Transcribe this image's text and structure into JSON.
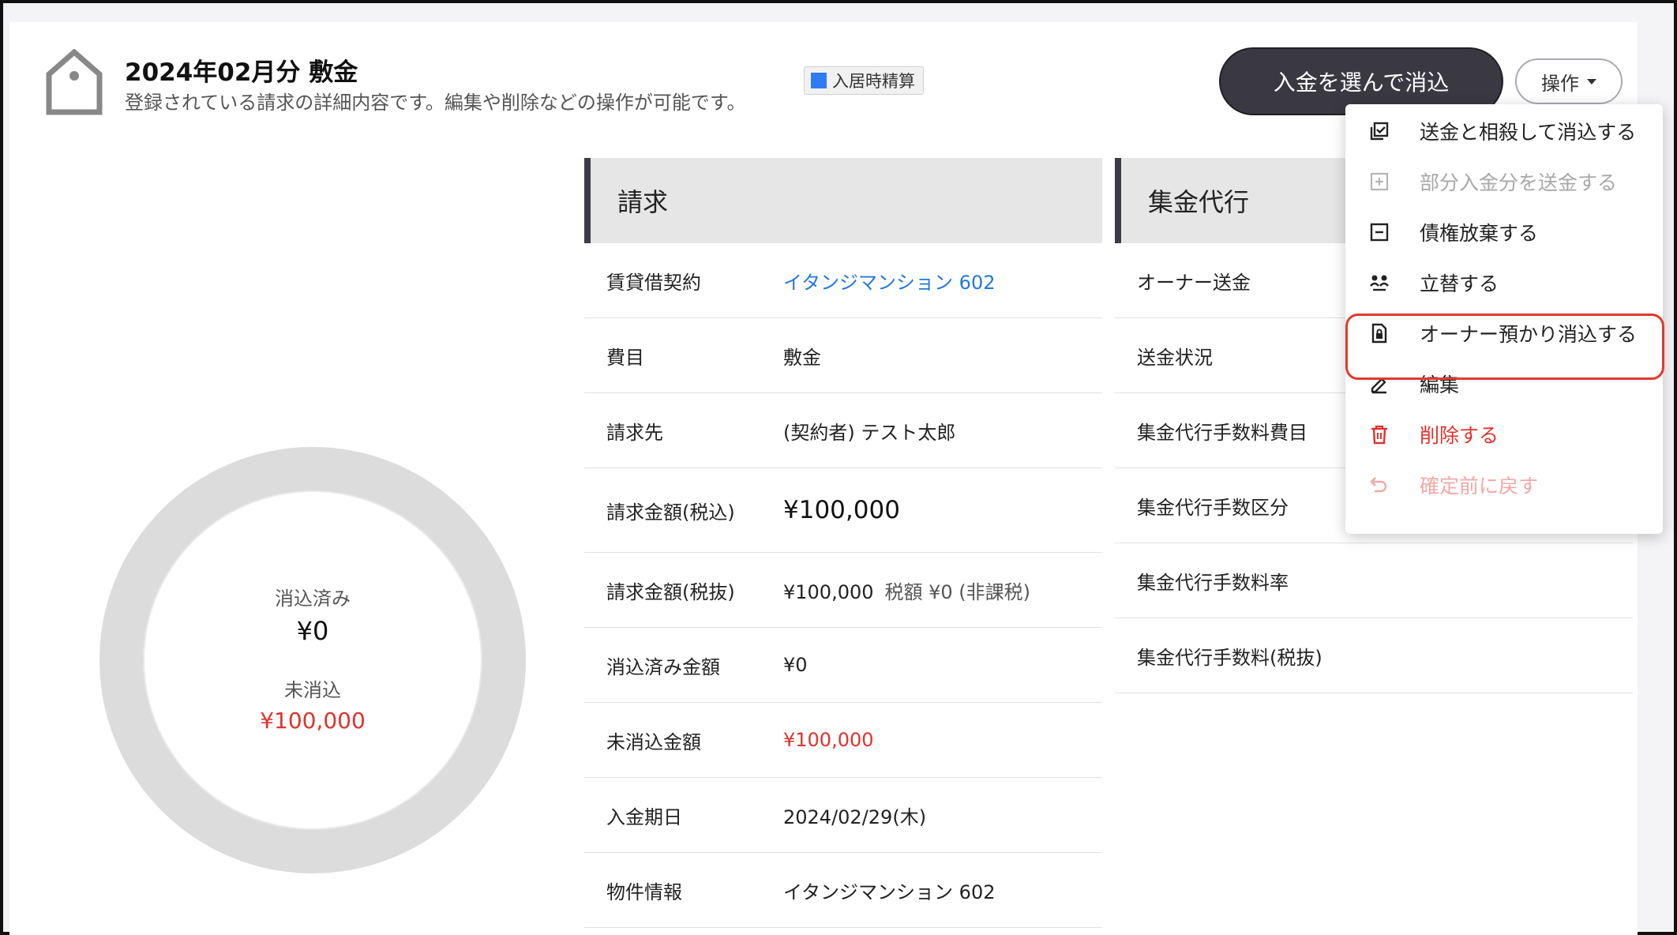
{
  "header": {
    "title": "2024年02月分 敷金",
    "subtitle": "登録されている請求の詳細内容です。編集や削除などの操作が可能です。",
    "badge_label": "入居時精算",
    "badge_color": "#2f7bf5",
    "primary_button": "入金を選んで消込",
    "ops_button": "操作"
  },
  "summary": {
    "cleared_label": "消込済み",
    "cleared_value": "¥0",
    "uncleared_label": "未消込",
    "uncleared_value": "¥100,000",
    "cleared_fraction": 0
  },
  "billing": {
    "heading": "請求",
    "rows": [
      {
        "label": "賃貸借契約",
        "value": "イタンジマンション 602"
      },
      {
        "label": "費目",
        "value": "敷金"
      },
      {
        "label": "請求先",
        "value": "(契約者) テスト太郎"
      },
      {
        "label": "請求金額(税込)",
        "value": "¥100,000"
      },
      {
        "label": "請求金額(税抜)",
        "value": "¥100,000",
        "sub": "税額 ¥0 (非課税)"
      },
      {
        "label": "消込済み金額",
        "value": "¥0"
      },
      {
        "label": "未消込金額",
        "value": "¥100,000"
      },
      {
        "label": "入金期日",
        "value": "2024/02/29(木)"
      },
      {
        "label": "物件情報",
        "value": "イタンジマンション 602"
      }
    ]
  },
  "collection": {
    "heading": "集金代行",
    "rows": [
      {
        "label": "オーナー送金"
      },
      {
        "label": "送金状況"
      },
      {
        "label": "集金代行手数料費目"
      },
      {
        "label": "集金代行手数区分"
      },
      {
        "label": "集金代行手数料率"
      },
      {
        "label": "集金代行手数料(税抜)"
      }
    ]
  },
  "menu": {
    "items": [
      {
        "label": "送金と相殺して消込する",
        "icon": "offset-clear-icon",
        "state": "enabled"
      },
      {
        "label": "部分入金分を送金する",
        "icon": "plus-square-icon",
        "state": "disabled"
      },
      {
        "label": "債権放棄する",
        "icon": "minus-square-icon",
        "state": "enabled"
      },
      {
        "label": "立替する",
        "icon": "advance-payment-icon",
        "state": "enabled"
      },
      {
        "label": "オーナー預かり消込する",
        "icon": "lock-document-icon",
        "state": "enabled",
        "highlighted": true
      },
      {
        "label": "編集",
        "icon": "pencil-icon",
        "state": "enabled"
      },
      {
        "label": "削除する",
        "icon": "trash-icon",
        "state": "danger"
      },
      {
        "label": "確定前に戻す",
        "icon": "undo-icon",
        "state": "disabled-danger"
      }
    ]
  },
  "colors": {
    "accent_link": "#2478d8",
    "danger": "#e0322d",
    "primary_button": "#3a3942"
  }
}
